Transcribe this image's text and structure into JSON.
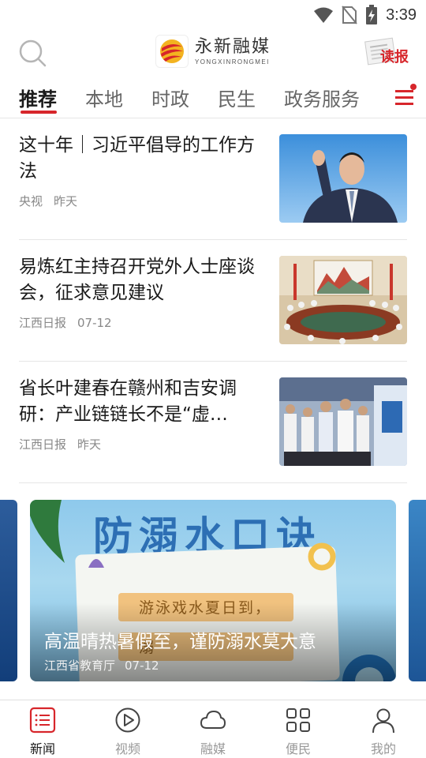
{
  "status_bar": {
    "time": "3:39"
  },
  "header": {
    "logo_cn": "永新融媒",
    "logo_en": "YONGXINRONGMEI",
    "read_label": "读报"
  },
  "tabs": [
    {
      "label": "推荐",
      "active": true
    },
    {
      "label": "本地"
    },
    {
      "label": "时政"
    },
    {
      "label": "民生"
    },
    {
      "label": "政务服务"
    }
  ],
  "news": [
    {
      "title": "这十年｜习近平倡导的工作方法",
      "source": "央视",
      "time": "昨天",
      "thumb": "leader-waving-photo"
    },
    {
      "title": "易炼红主持召开党外人士座谈会，征求意见建议",
      "source": "江西日报",
      "time": "07-12",
      "thumb": "conference-room-photo"
    },
    {
      "title": "省长叶建春在赣州和吉安调研：产业链链长不是“虚…",
      "source": "江西日报",
      "time": "昨天",
      "thumb": "inspection-photo"
    }
  ],
  "carousel": {
    "poster_title": "防溺水口诀",
    "poster_lines": [
      "游泳戏水夏日到，",
      "溺"
    ],
    "title": "高温晴热暑假至，谨防溺水莫大意",
    "source": "江西省教育厅",
    "date": "07-12"
  },
  "bottom_nav": [
    {
      "label": "新闻",
      "icon": "news-list-icon",
      "active": true
    },
    {
      "label": "视频",
      "icon": "play-icon"
    },
    {
      "label": "融媒",
      "icon": "cloud-icon"
    },
    {
      "label": "便民",
      "icon": "grid-icon"
    },
    {
      "label": "我的",
      "icon": "user-icon"
    }
  ],
  "colors": {
    "accent": "#d7262b",
    "text": "#1a1a1a",
    "muted": "#888888"
  }
}
